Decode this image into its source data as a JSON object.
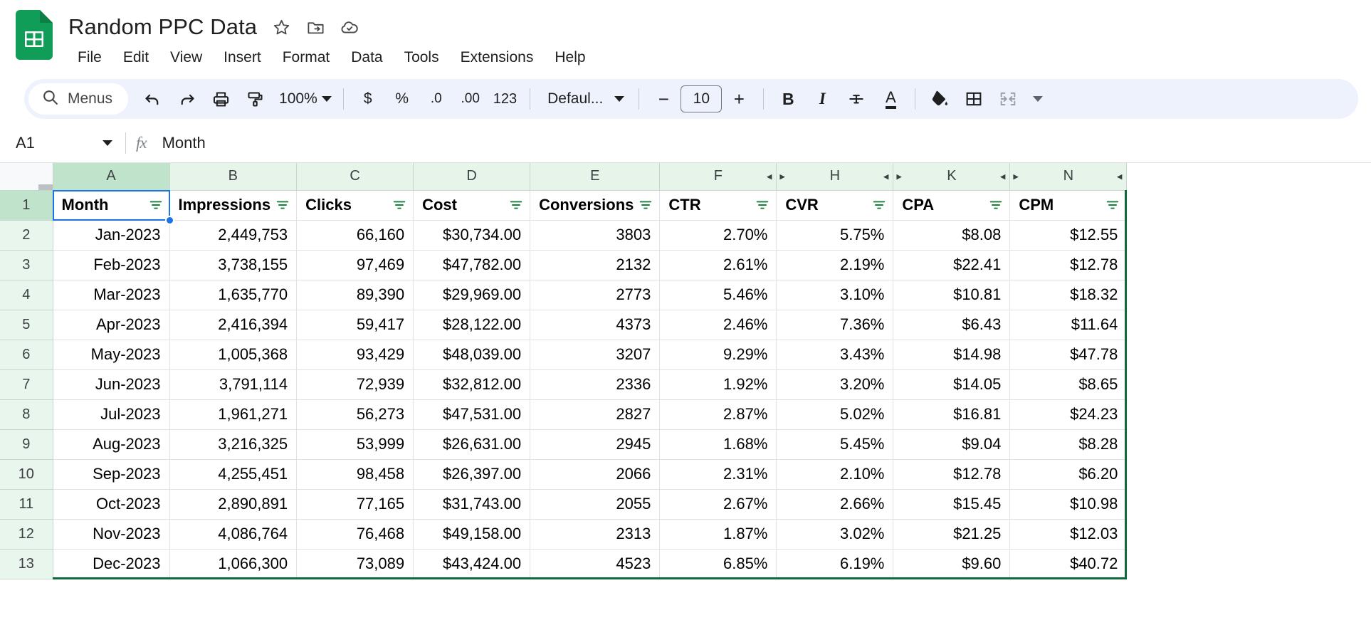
{
  "app": {
    "logo_icon": "sheets-logo-icon",
    "doc_title": "Random PPC Data",
    "title_icons": [
      {
        "name": "star-icon",
        "label": "Star"
      },
      {
        "name": "move-to-folder-icon",
        "label": "Move"
      },
      {
        "name": "cloud-saved-icon",
        "label": "Saved to Drive"
      }
    ],
    "menus": [
      "File",
      "Edit",
      "View",
      "Insert",
      "Format",
      "Data",
      "Tools",
      "Extensions",
      "Help"
    ]
  },
  "toolbar": {
    "search_icon": "search-icon",
    "menus_label": "Menus",
    "undo_icon": "undo-icon",
    "redo_icon": "redo-icon",
    "print_icon": "print-icon",
    "paint_format_icon": "paint-format-icon",
    "zoom_value": "100%",
    "currency_label": "$",
    "percent_label": "%",
    "decrease_decimal_label": ".0",
    "increase_decimal_label": ".00",
    "more_formats_label": "123",
    "font_name": "Defaul...",
    "decrease_font_label": "−",
    "font_size": "10",
    "increase_font_label": "+",
    "bold_label": "B",
    "italic_label": "I",
    "strikethrough_icon": "strikethrough-icon",
    "text_color_label": "A",
    "fill_color_icon": "fill-color-icon",
    "borders_icon": "borders-icon",
    "merge_cells_icon": "merge-cells-icon",
    "overflow_icon": "chevron-down-icon"
  },
  "formula_bar": {
    "name_box": "A1",
    "name_box_caret_icon": "chevron-down-icon",
    "fx_label": "fx",
    "formula_value": "Month"
  },
  "grid": {
    "column_letters": [
      "A",
      "B",
      "C",
      "D",
      "E",
      "F",
      "H",
      "K",
      "N"
    ],
    "selected_column": "A",
    "hidden_col_markers": [
      {
        "after": "F",
        "left_icon": "collapse-left-icon",
        "right_icon": "expand-right-icon"
      },
      {
        "after": "H",
        "left_icon": "collapse-left-icon",
        "right_icon": "expand-right-icon"
      },
      {
        "after": "K",
        "left_icon": "collapse-left-icon",
        "right_icon": "expand-right-icon"
      },
      {
        "after": "N",
        "left_icon": "collapse-left-icon",
        "right_icon": "expand-right-icon"
      }
    ],
    "row_numbers": [
      "1",
      "2",
      "3",
      "4",
      "5",
      "6",
      "7",
      "8",
      "9",
      "10",
      "11",
      "12",
      "13"
    ],
    "selected_row": "1",
    "active_cell": "A1",
    "headers": [
      "Month",
      "Impressions",
      "Clicks",
      "Cost",
      "Conversions",
      "CTR",
      "CVR",
      "CPA",
      "CPM"
    ],
    "filter_icon": "filter-icon",
    "rows": [
      [
        "Jan-2023",
        "2,449,753",
        "66,160",
        "$30,734.00",
        "3803",
        "2.70%",
        "5.75%",
        "$8.08",
        "$12.55"
      ],
      [
        "Feb-2023",
        "3,738,155",
        "97,469",
        "$47,782.00",
        "2132",
        "2.61%",
        "2.19%",
        "$22.41",
        "$12.78"
      ],
      [
        "Mar-2023",
        "1,635,770",
        "89,390",
        "$29,969.00",
        "2773",
        "5.46%",
        "3.10%",
        "$10.81",
        "$18.32"
      ],
      [
        "Apr-2023",
        "2,416,394",
        "59,417",
        "$28,122.00",
        "4373",
        "2.46%",
        "7.36%",
        "$6.43",
        "$11.64"
      ],
      [
        "May-2023",
        "1,005,368",
        "93,429",
        "$48,039.00",
        "3207",
        "9.29%",
        "3.43%",
        "$14.98",
        "$47.78"
      ],
      [
        "Jun-2023",
        "3,791,114",
        "72,939",
        "$32,812.00",
        "2336",
        "1.92%",
        "3.20%",
        "$14.05",
        "$8.65"
      ],
      [
        "Jul-2023",
        "1,961,271",
        "56,273",
        "$47,531.00",
        "2827",
        "2.87%",
        "5.02%",
        "$16.81",
        "$24.23"
      ],
      [
        "Aug-2023",
        "3,216,325",
        "53,999",
        "$26,631.00",
        "2945",
        "1.68%",
        "5.45%",
        "$9.04",
        "$8.28"
      ],
      [
        "Sep-2023",
        "4,255,451",
        "98,458",
        "$26,397.00",
        "2066",
        "2.31%",
        "2.10%",
        "$12.78",
        "$6.20"
      ],
      [
        "Oct-2023",
        "2,890,891",
        "77,165",
        "$31,743.00",
        "2055",
        "2.67%",
        "2.66%",
        "$15.45",
        "$10.98"
      ],
      [
        "Nov-2023",
        "4,086,764",
        "76,468",
        "$49,158.00",
        "2313",
        "1.87%",
        "3.02%",
        "$21.25",
        "$12.03"
      ],
      [
        "Dec-2023",
        "1,066,300",
        "73,089",
        "$43,424.00",
        "4523",
        "6.85%",
        "6.19%",
        "$9.60",
        "$40.72"
      ]
    ]
  },
  "colors": {
    "sheets_green": "#0f9d58",
    "header_green": "#e6f4ea",
    "header_green_selected": "#bfe3cb",
    "selection_blue": "#1a73e8",
    "filter_green": "#188038",
    "range_border": "#0b6b3a",
    "toolbar_bg": "#edf2fc"
  }
}
